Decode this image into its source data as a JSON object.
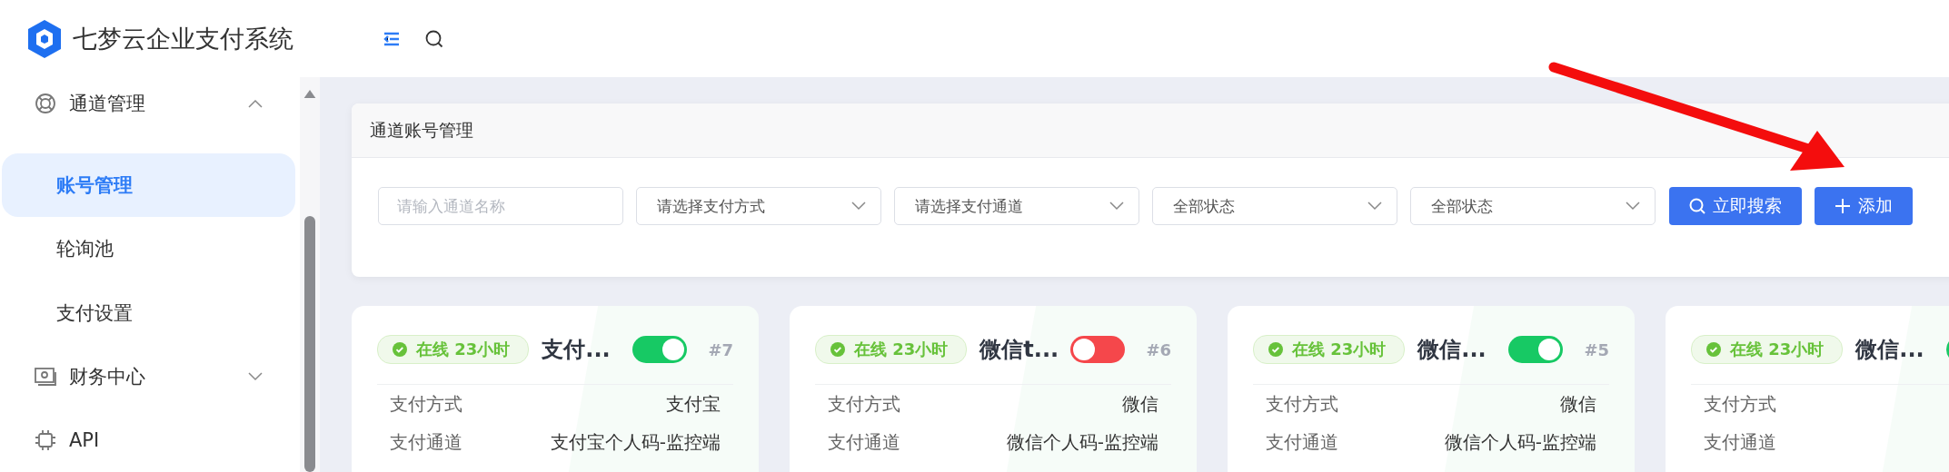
{
  "header": {
    "title": "七梦云企业支付系统"
  },
  "sidebar": {
    "items": [
      {
        "label": "通道管理",
        "expanded": true,
        "children": [
          {
            "label": "账号管理",
            "selected": true
          },
          {
            "label": "轮询池",
            "selected": false
          },
          {
            "label": "支付设置",
            "selected": false
          }
        ]
      },
      {
        "label": "财务中心",
        "expanded": false
      },
      {
        "label": "API"
      }
    ]
  },
  "search_panel": {
    "title": "通道账号管理",
    "name_field": {
      "placeholder": "请输入通道名称"
    },
    "selects": [
      {
        "value": "请选择支付方式"
      },
      {
        "value": "请选择支付通道"
      },
      {
        "value": "全部状态"
      },
      {
        "value": "全部状态"
      }
    ],
    "buttons": [
      {
        "kind": "search",
        "label": "立即搜索"
      },
      {
        "kind": "add",
        "label": "添加"
      }
    ]
  },
  "cards": [
    {
      "status": "在线 23小时",
      "name": "支付...",
      "on": true,
      "id": "#7",
      "fields": [
        {
          "label": "支付方式",
          "value": "支付宝"
        },
        {
          "label": "支付通道",
          "value": "支付宝个人码-监控端"
        }
      ]
    },
    {
      "status": "在线 23小时",
      "name": "微信t...",
      "on": false,
      "id": "#6",
      "fields": [
        {
          "label": "支付方式",
          "value": "微信"
        },
        {
          "label": "支付通道",
          "value": "微信个人码-监控端"
        }
      ]
    },
    {
      "status": "在线 23小时",
      "name": "微信...",
      "on": true,
      "id": "#5",
      "fields": [
        {
          "label": "支付方式",
          "value": "微信"
        },
        {
          "label": "支付通道",
          "value": "微信个人码-监控端"
        }
      ]
    },
    {
      "status": "在线 23小时",
      "name": "微信...",
      "on": true,
      "fields": [
        {
          "label": "支付方式"
        },
        {
          "label": "支付通道"
        }
      ]
    }
  ]
}
